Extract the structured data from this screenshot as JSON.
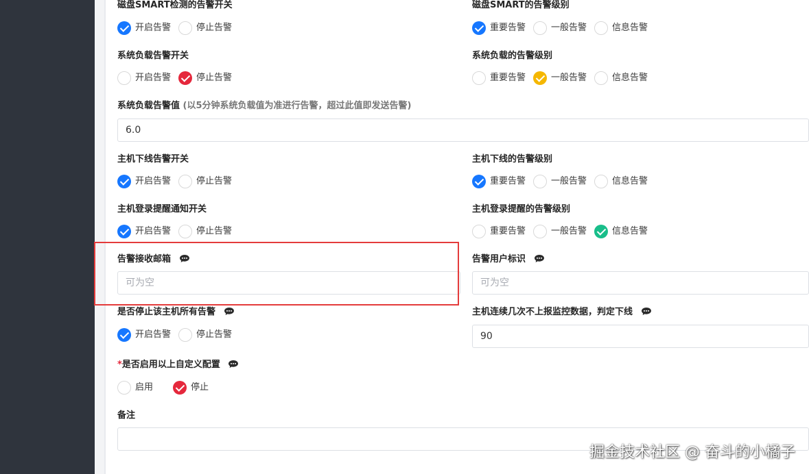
{
  "colors": {
    "blue": "#1677ff",
    "red": "#e5283c",
    "yellow": "#f5b700",
    "green": "#19be8a"
  },
  "smart": {
    "switch_label": "磁盘SMART检测的告警开关",
    "switch_on": "开启告警",
    "switch_off": "停止告警",
    "level_label": "磁盘SMART的告警级别",
    "level_important": "重要告警",
    "level_normal": "一般告警",
    "level_info": "信息告警"
  },
  "load": {
    "switch_label": "系统负载告警开关",
    "switch_on": "开启告警",
    "switch_off": "停止告警",
    "level_label": "系统负载的告警级别",
    "level_important": "重要告警",
    "level_normal": "一般告警",
    "level_info": "信息告警",
    "threshold_label": "系统负载告警值",
    "threshold_hint": "(以5分钟系统负载值为准进行告警，超过此值即发送告警)",
    "threshold_value": "6.0"
  },
  "offline": {
    "switch_label": "主机下线告警开关",
    "switch_on": "开启告警",
    "switch_off": "停止告警",
    "level_label": "主机下线的告警级别",
    "level_important": "重要告警",
    "level_normal": "一般告警",
    "level_info": "信息告警"
  },
  "login": {
    "switch_label": "主机登录提醒通知开关",
    "switch_on": "开启告警",
    "switch_off": "停止告警",
    "level_label": "主机登录提醒的告警级别",
    "level_important": "重要告警",
    "level_normal": "一般告警",
    "level_info": "信息告警"
  },
  "email": {
    "label": "告警接收邮箱",
    "placeholder": "可为空",
    "icon": "chat-bubble-icon"
  },
  "user_id": {
    "label": "告警用户标识",
    "placeholder": "可为空",
    "icon": "chat-bubble-icon"
  },
  "stop_all": {
    "label": "是否停止该主机所有告警",
    "switch_on": "开启告警",
    "switch_off": "停止告警"
  },
  "consecutive": {
    "label": "主机连续几次不上报监控数据，判定下线",
    "value": "90"
  },
  "custom": {
    "required_mark": "*",
    "label": "是否启用以上自定义配置",
    "enable": "启用",
    "disable": "停止"
  },
  "remark": {
    "label": "备注",
    "value": ""
  },
  "watermark": "掘金技术社区 @ 奋斗的小橘子"
}
